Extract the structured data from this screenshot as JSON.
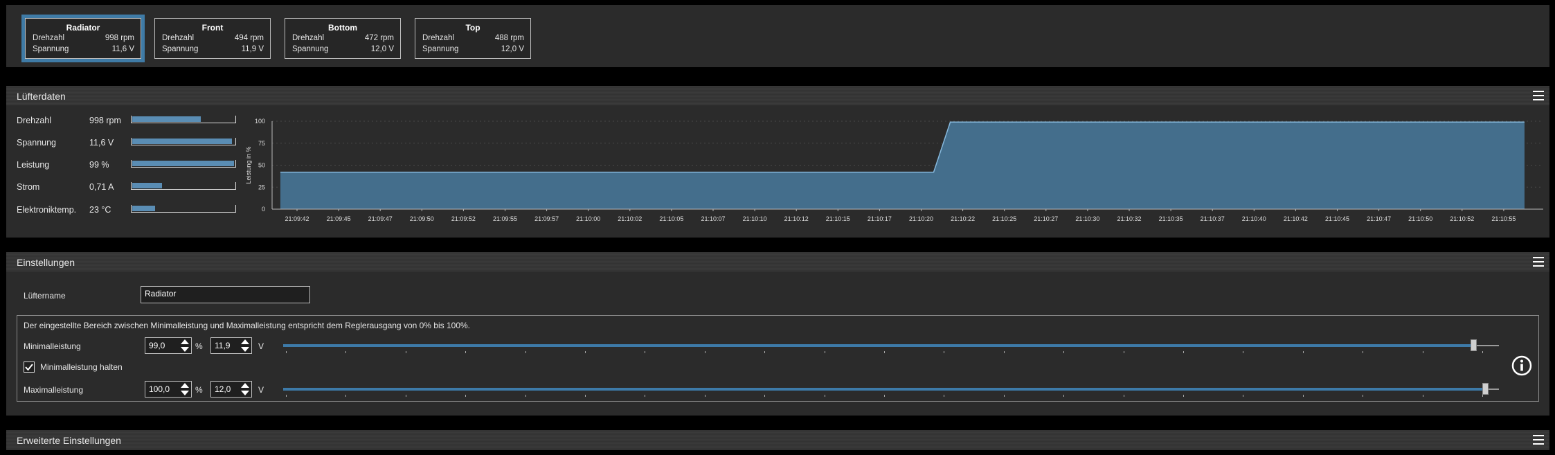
{
  "fans": [
    {
      "name": "Radiator",
      "speed_label": "Drehzahl",
      "speed": "998 rpm",
      "voltage_label": "Spannung",
      "voltage": "11,6 V",
      "selected": true
    },
    {
      "name": "Front",
      "speed_label": "Drehzahl",
      "speed": "494 rpm",
      "voltage_label": "Spannung",
      "voltage": "11,9 V",
      "selected": false
    },
    {
      "name": "Bottom",
      "speed_label": "Drehzahl",
      "speed": "472 rpm",
      "voltage_label": "Spannung",
      "voltage": "12,0 V",
      "selected": false
    },
    {
      "name": "Top",
      "speed_label": "Drehzahl",
      "speed": "488 rpm",
      "voltage_label": "Spannung",
      "voltage": "12,0 V",
      "selected": false
    }
  ],
  "fan_data": {
    "title": "Lüfterdaten",
    "rows": [
      {
        "label": "Drehzahl",
        "value": "998 rpm",
        "fill": 0.67
      },
      {
        "label": "Spannung",
        "value": "11,6 V",
        "fill": 0.97
      },
      {
        "label": "Leistung",
        "value": "99 %",
        "fill": 0.99
      },
      {
        "label": "Strom",
        "value": "0,71 A",
        "fill": 0.29
      },
      {
        "label": "Elektroniktemp.",
        "value": "23 °C",
        "fill": 0.22
      }
    ]
  },
  "chart_data": {
    "type": "area",
    "title": "",
    "xlabel": "",
    "ylabel": "Leistung in %",
    "ylim": [
      0,
      100
    ],
    "yticks": [
      "100",
      "75",
      "50",
      "25",
      "0"
    ],
    "grid": true,
    "color": "#446e8c",
    "line_color": "#86b8dc",
    "x": [
      "21:09:42",
      "21:09:45",
      "21:09:47",
      "21:09:50",
      "21:09:52",
      "21:09:55",
      "21:09:57",
      "21:10:00",
      "21:10:02",
      "21:10:05",
      "21:10:07",
      "21:10:10",
      "21:10:12",
      "21:10:15",
      "21:10:17",
      "21:10:20",
      "21:10:22",
      "21:10:25",
      "21:10:27",
      "21:10:30",
      "21:10:32",
      "21:10:35",
      "21:10:37",
      "21:10:40",
      "21:10:42",
      "21:10:45",
      "21:10:47",
      "21:10:50",
      "21:10:52",
      "21:10:55"
    ],
    "points": [
      {
        "t": -0.4,
        "v": 42
      },
      {
        "t": 15.3,
        "v": 42
      },
      {
        "t": 15.7,
        "v": 99
      },
      {
        "t": 29.5,
        "v": 99
      }
    ]
  },
  "settings": {
    "title": "Einstellungen",
    "fan_name_label": "Lüftername",
    "fan_name_value": "Radiator",
    "info_text": "Der eingestellte Bereich zwischen Minimalleistung und Maximalleistung entspricht dem Reglerausgang von 0% bis 100%.",
    "min_label": "Minimalleistung",
    "min_percent": "99,0",
    "min_volt": "11,9",
    "min_slider": 0.99,
    "hold_label": "Minimalleistung halten",
    "hold_checked": true,
    "max_label": "Maximalleistung",
    "max_percent": "100,0",
    "max_volt": "12,0",
    "max_slider": 1.0,
    "percent_unit": "%",
    "volt_unit": "V"
  },
  "advanced": {
    "title": "Erweiterte Einstellungen"
  }
}
